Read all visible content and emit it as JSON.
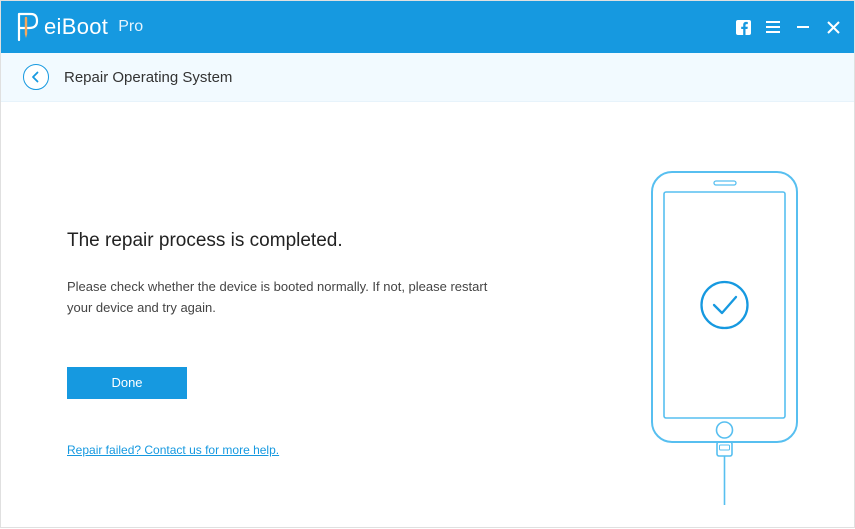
{
  "titlebar": {
    "brand_main": "eiBoot",
    "brand_suffix": "Pro"
  },
  "subheader": {
    "title": "Repair Operating System"
  },
  "main": {
    "headline": "The repair process is completed.",
    "description": "Please check whether the device is booted normally. If not, please restart your device and try again.",
    "done_label": "Done",
    "help_link_label": "Repair failed? Contact us for more help."
  }
}
